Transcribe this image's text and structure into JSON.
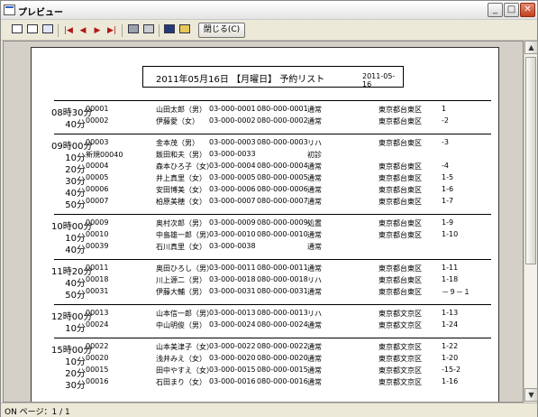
{
  "window": {
    "title": "プレビュー",
    "minimize": "_",
    "maximize": "□",
    "close": "✕"
  },
  "toolbar": {
    "icons": [
      "one-page-view-icon",
      "two-page-view-icon",
      "zoom-view-icon",
      "first-page-icon",
      "previous-page-icon",
      "next-page-icon",
      "last-page-icon",
      "print-setup-icon",
      "print-icon",
      "save-icon",
      "open-icon"
    ],
    "close_label": "閉じる(C)"
  },
  "report": {
    "title": "2011年05月16日 【月曜日】 予約リスト",
    "date": "2011-05-16",
    "groups": [
      {
        "rows": [
          {
            "time": "08時30分",
            "id": "00001",
            "name": "山田太郎（男）",
            "tel": "03-000-0001",
            "mobile": "080-000-0001",
            "type": "通常",
            "address": "東京都台東区",
            "suffix": "1"
          },
          {
            "time": "40分",
            "id": "00002",
            "name": "伊藤愛（女）",
            "tel": "03-000-0002",
            "mobile": "080-000-0002",
            "type": "通常",
            "address": "東京都台東区",
            "suffix": "-2"
          }
        ]
      },
      {
        "rows": [
          {
            "time": "09時00分",
            "id": "00003",
            "name": "金本茂（男）",
            "tel": "03-000-0003",
            "mobile": "080-000-0003",
            "type": "リハ",
            "address": "東京都台東区",
            "suffix": "-3"
          },
          {
            "time": "10分",
            "id": "新規00040",
            "name": "飯田和夫（男）",
            "tel": "03-000-0033",
            "mobile": "",
            "type": "初診",
            "address": "",
            "suffix": ""
          },
          {
            "time": "20分",
            "id": "00004",
            "name": "森本ひろ子（女）",
            "tel": "03-000-0004",
            "mobile": "080-000-0004",
            "type": "通常",
            "address": "東京都台東区",
            "suffix": "-4"
          },
          {
            "time": "30分",
            "id": "00005",
            "name": "井上真里（女）",
            "tel": "03-000-0005",
            "mobile": "080-000-0005",
            "type": "通常",
            "address": "東京都台東区",
            "suffix": "1-5"
          },
          {
            "time": "40分",
            "id": "00006",
            "name": "安田博美（女）",
            "tel": "03-000-0006",
            "mobile": "080-000-0006",
            "type": "通常",
            "address": "東京都台東区",
            "suffix": "1-6"
          },
          {
            "time": "50分",
            "id": "00007",
            "name": "柏原美穂（女）",
            "tel": "03-000-0007",
            "mobile": "080-000-0007",
            "type": "通常",
            "address": "東京都台東区",
            "suffix": "1-7"
          }
        ]
      },
      {
        "rows": [
          {
            "time": "10時00分",
            "id": "00009",
            "name": "奥村次郎（男）",
            "tel": "03-000-0009",
            "mobile": "080-000-0009",
            "type": "処置",
            "address": "東京都台東区",
            "suffix": "1-9"
          },
          {
            "time": "10分",
            "id": "00010",
            "name": "中島雄一郎（男）",
            "tel": "03-000-0010",
            "mobile": "080-000-0010",
            "type": "通常",
            "address": "東京都台東区",
            "suffix": "1-10"
          },
          {
            "time": "40分",
            "id": "00039",
            "name": "石川真里（女）",
            "tel": "03-000-0038",
            "mobile": "",
            "type": "通常",
            "address": "",
            "suffix": ""
          }
        ]
      },
      {
        "rows": [
          {
            "time": "11時20分",
            "id": "00011",
            "name": "奥田ひろし（男）",
            "tel": "03-000-0011",
            "mobile": "080-000-0011",
            "type": "通常",
            "address": "東京都台東区",
            "suffix": "1-11"
          },
          {
            "time": "40分",
            "id": "00018",
            "name": "川上源二（男）",
            "tel": "03-000-0018",
            "mobile": "080-000-0018",
            "type": "リハ",
            "address": "東京都台東区",
            "suffix": "1-18"
          },
          {
            "time": "50分",
            "id": "00031",
            "name": "伊藤大輔（男）",
            "tel": "03-000-0031",
            "mobile": "080-000-0031",
            "type": "通常",
            "address": "東京都台東区",
            "suffix": "－９－１"
          }
        ]
      },
      {
        "rows": [
          {
            "time": "12時00分",
            "id": "00013",
            "name": "山本信一郎（男）",
            "tel": "03-000-0013",
            "mobile": "080-000-0013",
            "type": "リハ",
            "address": "東京都文京区",
            "suffix": "1-13"
          },
          {
            "time": "10分",
            "id": "00024",
            "name": "中山明俊（男）",
            "tel": "03-000-0024",
            "mobile": "080-000-0024",
            "type": "通常",
            "address": "東京都文京区",
            "suffix": "1-24"
          }
        ]
      },
      {
        "rows": [
          {
            "time": "15時00分",
            "id": "00022",
            "name": "山本美津子（女）",
            "tel": "03-000-0022",
            "mobile": "080-000-0022",
            "type": "通常",
            "address": "東京都文京区",
            "suffix": "1-22"
          },
          {
            "time": "10分",
            "id": "00020",
            "name": "浅井みえ（女）",
            "tel": "03-000-0020",
            "mobile": "080-000-0020",
            "type": "通常",
            "address": "東京都文京区",
            "suffix": "1-20"
          },
          {
            "time": "20分",
            "id": "00015",
            "name": "田中やすえ（女）",
            "tel": "03-000-0015",
            "mobile": "080-000-0015",
            "type": "通常",
            "address": "東京都文京区",
            "suffix": "-15-2"
          },
          {
            "time": "30分",
            "id": "00016",
            "name": "石田まり（女）",
            "tel": "03-000-0016",
            "mobile": "080-000-0016",
            "type": "通常",
            "address": "東京都文京区",
            "suffix": "1-16"
          }
        ]
      }
    ]
  },
  "status": {
    "text": "ON ページ：1 / 1"
  },
  "scrollbar": {
    "up": "▲",
    "down": "▼"
  }
}
